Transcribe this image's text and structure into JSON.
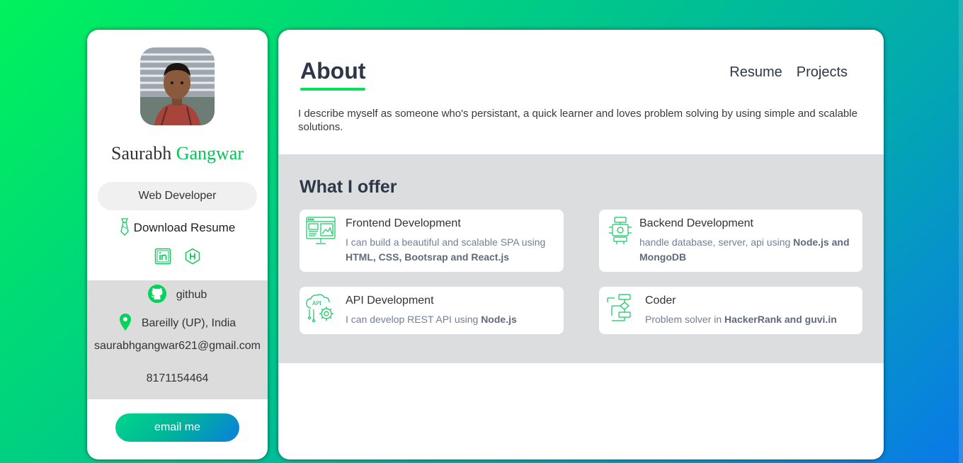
{
  "sidebar": {
    "first_name": "Saurabh",
    "last_name": "Gangwar",
    "role": "Web Developer",
    "download_label": "Download Resume",
    "socials": [
      {
        "icon": "linkedin-icon"
      },
      {
        "icon": "hackerrank-icon"
      }
    ],
    "contact": {
      "github_label": "github",
      "location": "Bareilly (UP), India",
      "email": "saurabhgangwar621@gmail.com",
      "phone": "8171154464"
    },
    "email_button": "email me"
  },
  "main": {
    "title": "About",
    "nav": [
      "Resume",
      "Projects"
    ],
    "about_text": "I describe myself as someone who's persistant, a quick learner and loves problem solving by using simple and scalable solutions.",
    "offer_title": "What I offer",
    "services": [
      {
        "title": "Frontend Development",
        "desc_plain": "I can build a beautiful and scalable SPA using ",
        "desc_bold": "HTML, CSS, Bootsrap and React.js",
        "icon": "frontend-icon"
      },
      {
        "title": "Backend Development",
        "desc_plain": "handle database, server, api using ",
        "desc_bold": "Node.js and MongoDB",
        "icon": "backend-icon"
      },
      {
        "title": "API Development",
        "desc_plain": "I can develop REST API using ",
        "desc_bold": "Node.js",
        "icon": "api-icon"
      },
      {
        "title": "Coder",
        "desc_plain": "Problem solver in ",
        "desc_bold": "HackerRank and guvi.in",
        "icon": "coder-icon"
      }
    ]
  },
  "colors": {
    "accent": "#00e05a",
    "heading": "#2d3748",
    "panel_grey": "#dcdddf"
  }
}
